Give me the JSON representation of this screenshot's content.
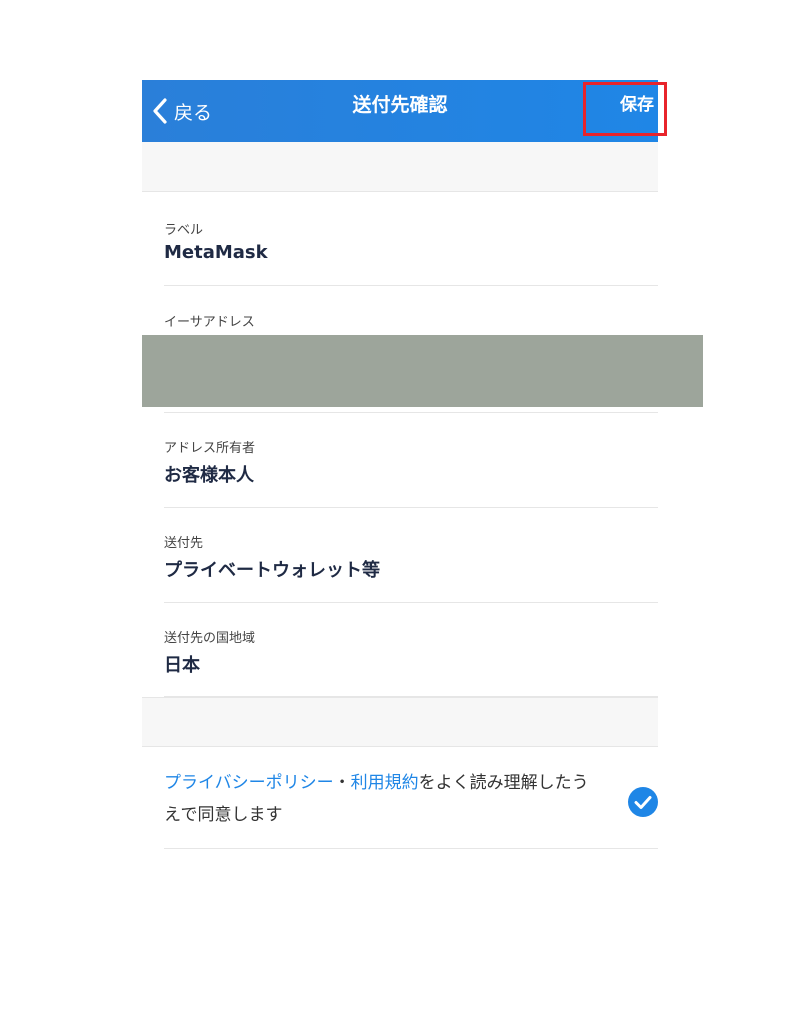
{
  "navbar": {
    "back_label": "戻る",
    "title": "送付先確認",
    "save_label": "保存"
  },
  "fields": [
    {
      "label": "ラベル",
      "value": "MetaMask"
    },
    {
      "label": "イーサアドレス",
      "value": ""
    },
    {
      "label": "アドレス所有者",
      "value": "お客様本人"
    },
    {
      "label": "送付先",
      "value": "プライベートウォレット等"
    },
    {
      "label": "送付先の国地域",
      "value": "日本"
    }
  ],
  "consent": {
    "privacy_link": "プライバシーポリシー",
    "separator": "・",
    "terms_link": "利用規約",
    "text_after_links": "をよく読み理解したうえで同意します",
    "checked": true
  },
  "colors": {
    "navbar": "#1f86e6",
    "link": "#1f86e6",
    "highlight": "#e8242b",
    "redaction": "#9da59b"
  }
}
